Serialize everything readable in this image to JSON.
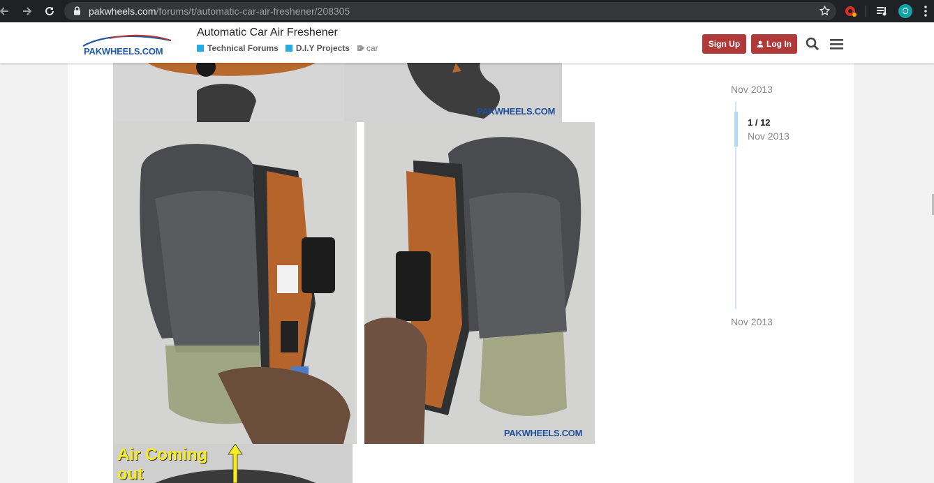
{
  "browser": {
    "url_host": "pakwheels.com",
    "url_path": "/forums/t/automatic-car-air-freshener/208305",
    "profile_initial": "O"
  },
  "header": {
    "logo_text": "PAKWHEELS.COM",
    "topic_title": "Automatic Car Air Freshener",
    "categories": [
      {
        "label": "Technical Forums",
        "color": "#25aae1"
      },
      {
        "label": "D.I.Y Projects",
        "color": "#25aae1"
      }
    ],
    "tag": "car",
    "signup_label": "Sign Up",
    "login_label": "Log In",
    "brand_color": "#b03a39"
  },
  "post": {
    "watermark": "PAKWHEELS.COM",
    "bottom_caption_line1": "Air Coming",
    "bottom_caption_line2": "out"
  },
  "timeline": {
    "start_date": "Nov 2013",
    "position": "1 / 12",
    "position_date": "Nov 2013",
    "end_date": "Nov 2013"
  }
}
